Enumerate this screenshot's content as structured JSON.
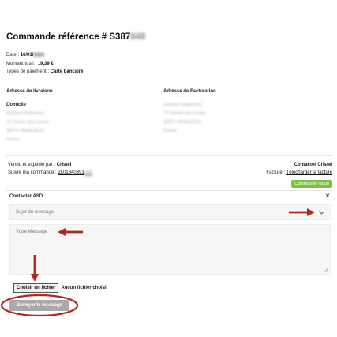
{
  "order": {
    "title_prefix": "Commande référence # S387",
    "title_blurred": "848",
    "date_label": "Date :",
    "date_day": "16/01/",
    "date_year": "2024",
    "total_label": "Montant total :",
    "total_value": "19,39 €",
    "payment_label": "Types de paiement :",
    "payment_value": "Carte bancaire"
  },
  "shipping": {
    "heading": "Adresse de livraison",
    "name": "Domicile",
    "lines": [
      "Sylvaine Guillermoz",
      "72 chemin des roches",
      "38470 VARACIEUX",
      "France"
    ]
  },
  "billing": {
    "heading": "Adresse de Facturation",
    "lines": [
      "Sylvaine Guillermoz",
      "72 chemin des roches",
      "38470 VARACIEUX",
      "France"
    ]
  },
  "seller": {
    "sold_label": "Vendu et expédié par :",
    "sold_value": "Cristel",
    "track_label": "Suivre ma commande :",
    "track_value": "2L01840391",
    "track_blurred": "306",
    "contact_link": "Contacter Cristel",
    "invoice_label": "Facture :",
    "invoice_link": "Télécharger la facture",
    "status_badge": "Commande reçue"
  },
  "contact_form": {
    "heading": "Contacter ASD",
    "close_icon": "×",
    "subject_placeholder": "Sujet du message",
    "message_placeholder": "Votre Message",
    "file_button": "Choisir un fichier",
    "file_status": "Aucun fichier choisi",
    "send_button": "Envoyer le message"
  },
  "colors": {
    "annotation_red": "#b3261e",
    "status_green": "#7cc242",
    "send_button_gray": "#a9a9a9"
  }
}
